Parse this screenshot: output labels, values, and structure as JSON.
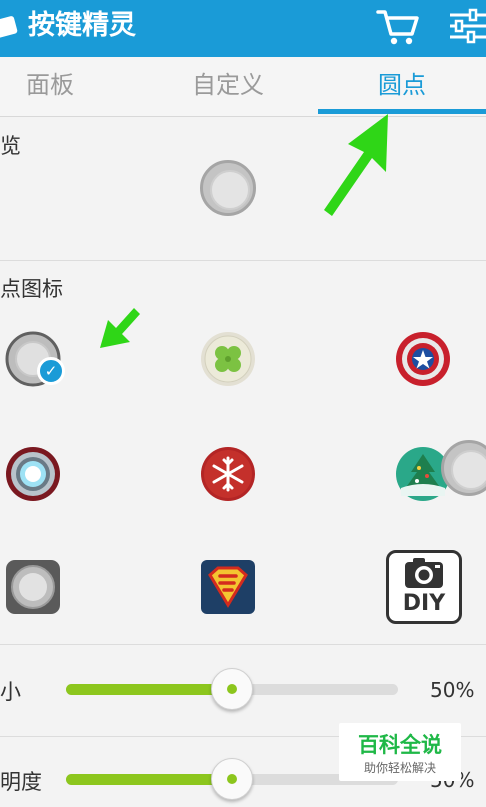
{
  "app": {
    "title": "按键精灵"
  },
  "tabs": [
    {
      "label": "面板",
      "active": false
    },
    {
      "label": "自定义",
      "active": false
    },
    {
      "label": "圆点",
      "active": true
    }
  ],
  "sections": {
    "preview": {
      "label": "览"
    },
    "icon": {
      "label": "点图标"
    }
  },
  "icons": [
    {
      "name": "default-dot",
      "selected": true
    },
    {
      "name": "clover"
    },
    {
      "name": "captain-america-shield"
    },
    {
      "name": "iron-man-reactor"
    },
    {
      "name": "snowflake"
    },
    {
      "name": "christmas-tree"
    },
    {
      "name": "square-dot"
    },
    {
      "name": "superman"
    },
    {
      "name": "camera-diy",
      "label": "DIY"
    }
  ],
  "sliders": [
    {
      "label": "小",
      "value_text": "50%",
      "value": 0.5
    },
    {
      "label": "明度",
      "value_text": "50%",
      "value": 0.5
    }
  ],
  "watermark": {
    "title": "百科全说",
    "subtitle": "助你轻松解决"
  },
  "colors": {
    "accent": "#1a9bd7",
    "slider": "#8cc61d",
    "arrow": "#2fd617"
  }
}
